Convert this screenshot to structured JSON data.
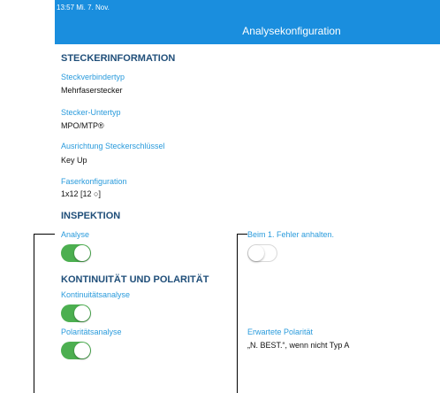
{
  "status_bar": {
    "time_date": "13:57  Mi. 7. Nov."
  },
  "header": {
    "title": "Analysekonfiguration"
  },
  "connector": {
    "heading": "STECKERINFORMATION",
    "connector_type_label": "Steckverbindertyp",
    "connector_type_value": "Mehrfaserstecker",
    "subtype_label": "Stecker-Untertyp",
    "subtype_value": "MPO/MTP®",
    "key_label": "Ausrichtung Steckerschlüssel",
    "key_value": "Key Up",
    "fiber_label": "Faserkonfiguration",
    "fiber_value": "1x12 [12 ○]"
  },
  "inspection": {
    "heading": "INSPEKTION",
    "analysis_label": "Analyse",
    "analysis_on": true,
    "stop_label": "Beim 1. Fehler anhalten.",
    "stop_on": false
  },
  "continuity": {
    "heading": "KONTINUITÄT UND POLARITÄT",
    "continuity_label": "Kontinuitätsanalyse",
    "continuity_on": true,
    "polarity_label": "Polaritätsanalyse",
    "polarity_on": true,
    "expected_label": "Erwartete Polarität",
    "expected_value": "„N. BEST.“, wenn nicht Typ A"
  },
  "colors": {
    "accent": "#1a8ede",
    "toggle_on": "#4caf50",
    "heading": "#1f4e79",
    "label": "#2a9bdc"
  }
}
